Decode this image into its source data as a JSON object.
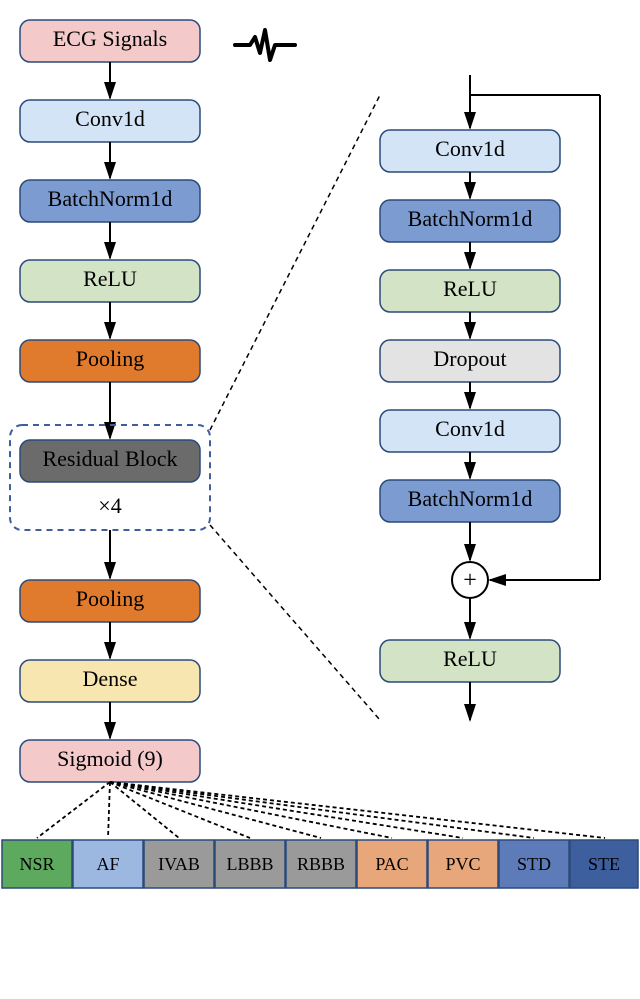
{
  "diagram": {
    "input": "ECG Signals",
    "main_blocks": {
      "conv": "Conv1d",
      "bn": "BatchNorm1d",
      "relu": "ReLU",
      "pool": "Pooling",
      "res": "Residual Block",
      "res_mult": "×4",
      "pool2": "Pooling",
      "dense": "Dense",
      "sigmoid": "Sigmoid (9)"
    },
    "res_blocks": {
      "conv1": "Conv1d",
      "bn1": "BatchNorm1d",
      "relu1": "ReLU",
      "dropout": "Dropout",
      "conv2": "Conv1d",
      "bn2": "BatchNorm1d",
      "add": "+",
      "relu2": "ReLU"
    },
    "outputs": [
      "NSR",
      "AF",
      "IVAB",
      "LBBB",
      "RBBB",
      "PAC",
      "PVC",
      "STD",
      "STE"
    ]
  },
  "colors": {
    "input": "#f3c9c9",
    "conv": "#d4e4f7",
    "bn": "#7b9bd1",
    "relu": "#d3e3c6",
    "pool": "#e07b2e",
    "res": "#6b6b6b",
    "dropout": "#e3e3e3",
    "dense": "#f7e6b0",
    "sigmoid": "#f3c9c9",
    "out": [
      "#5da95d",
      "#9cb8e0",
      "#9a9a9a",
      "#9a9a9a",
      "#9a9a9a",
      "#e8a77a",
      "#e8a77a",
      "#5c7bb8",
      "#3e5f9e"
    ]
  }
}
